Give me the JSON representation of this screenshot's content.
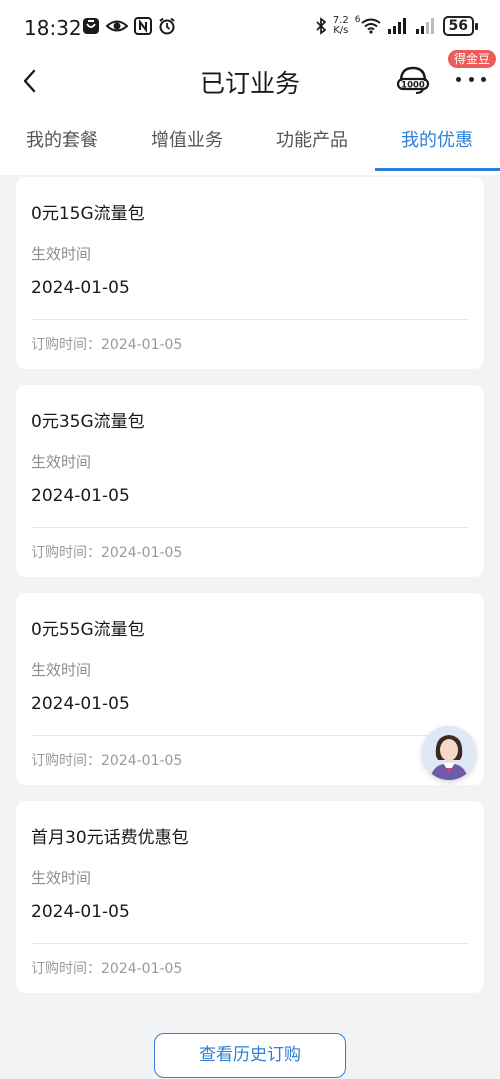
{
  "status_bar": {
    "time": "18:32",
    "network_speed_value": "7.2",
    "network_speed_unit": "K/s",
    "wifi_label": "6",
    "battery": "56",
    "icons": [
      "app-notification-icon",
      "eye-icon",
      "nfc-icon",
      "alarm-icon",
      "bluetooth-icon",
      "wifi-icon",
      "signal-icon",
      "signal-icon-2",
      "battery-icon"
    ]
  },
  "header": {
    "title": "已订业务",
    "coin_badge": "得金豆",
    "service_icon": "headset-10000-icon",
    "more_icon": "more-icon"
  },
  "tabs": [
    {
      "label": "我的套餐",
      "active": false
    },
    {
      "label": "增值业务",
      "active": false
    },
    {
      "label": "功能产品",
      "active": false
    },
    {
      "label": "我的优惠",
      "active": true
    }
  ],
  "cards": [
    {
      "title": "0元15G流量包",
      "effective_label": "生效时间",
      "effective_date": "2024-01-05",
      "order_time": "订购时间：2024-01-05"
    },
    {
      "title": "0元35G流量包",
      "effective_label": "生效时间",
      "effective_date": "2024-01-05",
      "order_time": "订购时间：2024-01-05"
    },
    {
      "title": "0元55G流量包",
      "effective_label": "生效时间",
      "effective_date": "2024-01-05",
      "order_time": "订购时间：2024-01-05"
    },
    {
      "title": "首月30元话费优惠包",
      "effective_label": "生效时间",
      "effective_date": "2024-01-05",
      "order_time": "订购时间：2024-01-05"
    }
  ],
  "history_button": "查看历史订购",
  "colors": {
    "accent": "#2d7fd7",
    "background": "#f2f3f5",
    "badge": "#ee5b5b"
  }
}
